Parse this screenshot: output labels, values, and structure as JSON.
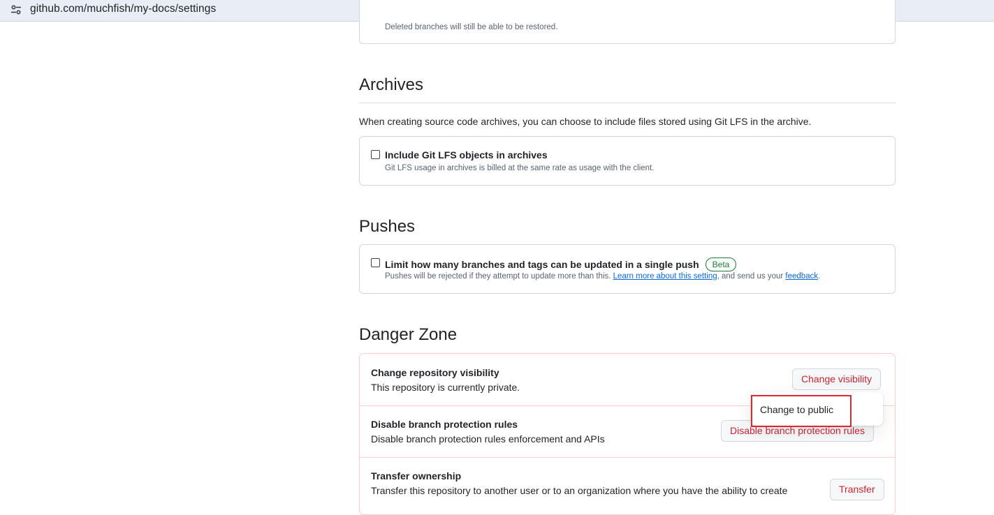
{
  "browser": {
    "url": "github.com/muchfish/my-docs/settings",
    "site_icon": "tune-icon"
  },
  "branches": {
    "deleted_note": "Deleted branches will still be able to be restored."
  },
  "archives": {
    "title": "Archives",
    "description": "When creating source code archives, you can choose to include files stored using Git LFS in the archive.",
    "option_label": "Include Git LFS objects in archives",
    "option_note": "Git LFS usage in archives is billed at the same rate as usage with the client.",
    "checked": false
  },
  "pushes": {
    "title": "Pushes",
    "option_label": "Limit how many branches and tags can be updated in a single push",
    "badge": "Beta",
    "note_prefix": "Pushes will be rejected if they attempt to update more than this. ",
    "learn_more_link": "Learn more about this setting",
    "note_middle": ", and send us your ",
    "feedback_link": "feedback",
    "note_suffix": ".",
    "checked": false
  },
  "danger_zone": {
    "title": "Danger Zone",
    "rows": [
      {
        "title": "Change repository visibility",
        "description": "This repository is currently private.",
        "button": "Change visibility"
      },
      {
        "title": "Disable branch protection rules",
        "description": "Disable branch protection rules enforcement and APIs",
        "button": "Disable branch protection rules"
      },
      {
        "title": "Transfer ownership",
        "description": "Transfer this repository to another user or to an organization where you have the ability to create",
        "button": "Transfer"
      }
    ],
    "visibility_menu": {
      "items": [
        "Change to public"
      ]
    }
  },
  "colors": {
    "danger": "#cf222e",
    "danger_border": "#ffcecb",
    "link": "#0969da",
    "beta": "#1a7f37",
    "annotation": "#e0262e"
  }
}
